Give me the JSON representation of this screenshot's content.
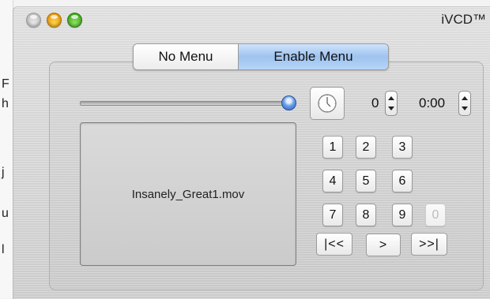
{
  "background_window": {
    "chars": [
      "F",
      "h",
      "j",
      "u",
      "l"
    ]
  },
  "window": {
    "title": "iVCD™",
    "controls": [
      "close",
      "minimize",
      "zoom"
    ]
  },
  "menu_toggle": {
    "options": [
      "No Menu",
      "Enable Menu"
    ],
    "selected": "Enable Menu"
  },
  "playback": {
    "position_fraction": 1.0,
    "clock_icon": "clock-icon",
    "chapter": "0",
    "time": "0:00",
    "file_name": "Insanely_Great1.mov"
  },
  "keypad": {
    "rows": [
      [
        "1",
        "2",
        "3"
      ],
      [
        "4",
        "5",
        "6"
      ],
      [
        "7",
        "8",
        "9"
      ]
    ],
    "zero": "0",
    "zero_enabled": false
  },
  "transport": {
    "prev": "|<<",
    "play": ">",
    "next": ">>|"
  },
  "colors": {
    "selected_segment": "#9ec3ef",
    "slider_knob": "#2a5fc8",
    "close": "#b8b8b8",
    "minimize": "#e08a00",
    "zoom": "#2f9b12"
  }
}
